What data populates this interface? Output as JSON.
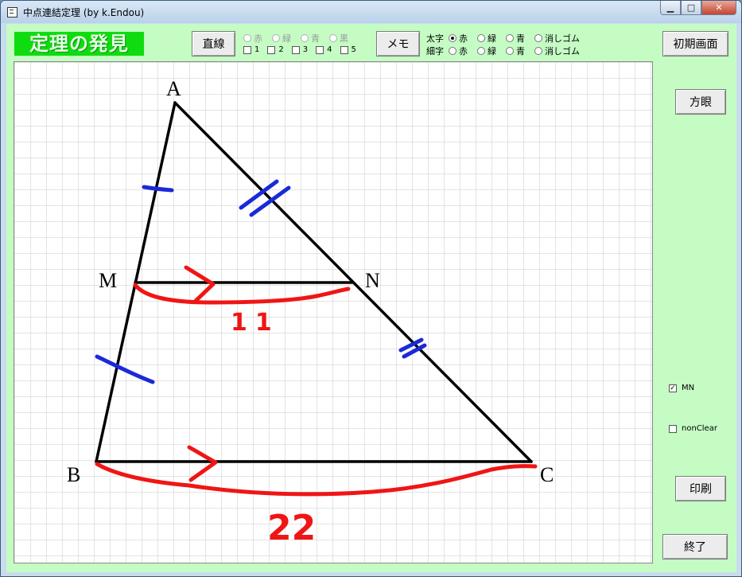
{
  "window": {
    "title": "中点連結定理 (by k.Endou)"
  },
  "logo": "定理の発見",
  "toolbar": {
    "line_button": "直線",
    "line_colors": [
      "赤",
      "緑",
      "青",
      "黒"
    ],
    "line_widths": [
      "1",
      "2",
      "3",
      "4",
      "5"
    ],
    "memo_button": "メモ",
    "thick_label": "太字",
    "thin_label": "細字",
    "memo_colors": [
      "赤",
      "緑",
      "青",
      "消しゴム"
    ],
    "reset_button": "初期画面"
  },
  "side": {
    "grid_button": "方眼",
    "mn_label": "MN",
    "mn_checked": true,
    "nonclear_label": "nonClear",
    "nonclear_checked": false,
    "print_button": "印刷",
    "exit_button": "終了"
  },
  "figure": {
    "labels": {
      "A": "A",
      "B": "B",
      "C": "C",
      "M": "M",
      "N": "N"
    },
    "length_mn": "11",
    "length_bc": "22"
  }
}
